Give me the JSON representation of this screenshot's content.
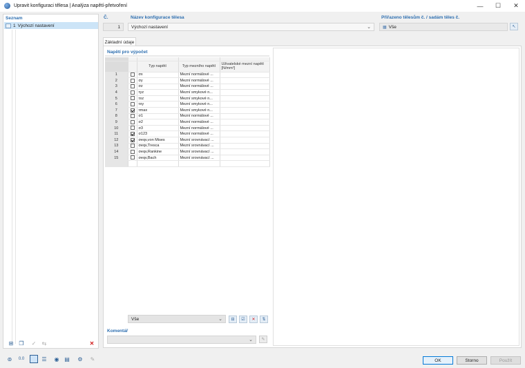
{
  "window": {
    "title": "Upravit konfiguraci tělesa | Analýza napětí-přetvoření",
    "minimize": "—",
    "maximize": "☐",
    "close": "✕"
  },
  "list": {
    "label": "Seznam",
    "items": [
      {
        "number": "1",
        "name": "Výchozí nastavení"
      }
    ]
  },
  "header": {
    "no_label": "Č.",
    "no_value": "1",
    "name_label": "Název konfigurace tělesa",
    "name_value": "Výchozí nastavení",
    "assigned_label": "Přiřazeno tělesům č. / sadám těles č.",
    "assigned_value": "Vše"
  },
  "tabs": [
    {
      "label": "Základní údaje"
    }
  ],
  "stress_table": {
    "section_label": "Napětí pro výpočet",
    "columns": [
      "Typ napětí",
      "Typ mezního napětí",
      "Uživatelské mezní napětí [N/mm²]"
    ],
    "rows": [
      {
        "no": "1",
        "checked": false,
        "stress": "σx",
        "limit": "Mezní normálové ..."
      },
      {
        "no": "2",
        "checked": false,
        "stress": "σy",
        "limit": "Mezní normálové ..."
      },
      {
        "no": "3",
        "checked": false,
        "stress": "σz",
        "limit": "Mezní normálové ..."
      },
      {
        "no": "4",
        "checked": false,
        "stress": "τyz",
        "limit": "Mezní smykové n..."
      },
      {
        "no": "5",
        "checked": false,
        "stress": "τxz",
        "limit": "Mezní smykové n..."
      },
      {
        "no": "6",
        "checked": false,
        "stress": "τxy",
        "limit": "Mezní smykové n..."
      },
      {
        "no": "7",
        "checked": true,
        "stress": "τmax",
        "limit": "Mezní smykové n..."
      },
      {
        "no": "8",
        "checked": false,
        "stress": "σ1",
        "limit": "Mezní normálové ..."
      },
      {
        "no": "9",
        "checked": false,
        "stress": "σ2",
        "limit": "Mezní normálové ..."
      },
      {
        "no": "10",
        "checked": false,
        "stress": "σ3",
        "limit": "Mezní normálové ..."
      },
      {
        "no": "11",
        "checked": true,
        "stress": "σ123",
        "limit": "Mezní normálové ..."
      },
      {
        "no": "12",
        "checked": true,
        "stress": "σeqv,von Mises",
        "limit": "Mezní srovnávací ..."
      },
      {
        "no": "13",
        "checked": false,
        "stress": "σeqv,Tresca",
        "limit": "Mezní srovnávací ..."
      },
      {
        "no": "14",
        "checked": false,
        "stress": "σeqv,Rankine",
        "limit": "Mezní srovnávací ..."
      },
      {
        "no": "15",
        "checked": false,
        "stress": "σeqv,Bach",
        "limit": "Mezní srovnávací ..."
      }
    ],
    "filter_value": "Vše"
  },
  "comment": {
    "label": "Komentář",
    "value": ""
  },
  "footer": {
    "ok": "OK",
    "cancel": "Storno",
    "apply": "Použít"
  },
  "colors": {
    "accent": "#2e6fb0",
    "selection": "#cce4f7"
  }
}
